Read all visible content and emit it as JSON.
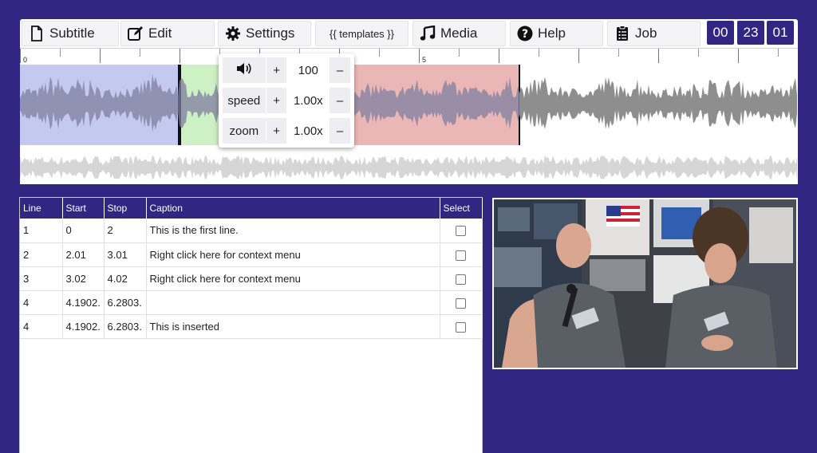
{
  "toolbar": {
    "subtitle": "Subtitle",
    "edit": "Edit",
    "settings": "Settings",
    "templates": "{{ templates }}",
    "media": "Media",
    "help": "Help",
    "job": "Job",
    "icons": [
      "file-icon",
      "edit-icon",
      "gear-icon",
      "music-icon",
      "help-icon",
      "clipboard-icon"
    ]
  },
  "timer": {
    "hours": "00",
    "minutes": "23",
    "seconds": "01"
  },
  "ruler": {
    "mark0": "0",
    "mark5": "5"
  },
  "audio": {
    "volume_value": "100",
    "speed_label": "speed",
    "speed_value": "1.00x",
    "zoom_label": "zoom",
    "zoom_value": "1.00x",
    "plus": "+",
    "minus": "–"
  },
  "table": {
    "headers": [
      "Line",
      "Start",
      "Stop",
      "Caption",
      "Select"
    ],
    "rows": [
      {
        "line": "1",
        "start": "0",
        "stop": "2",
        "caption": "This is the first line."
      },
      {
        "line": "2",
        "start": "2.01",
        "stop": "3.01",
        "caption": "Right click here for context menu"
      },
      {
        "line": "3",
        "start": "3.02",
        "stop": "4.02",
        "caption": "Right click here for context menu"
      },
      {
        "line": "4",
        "start": "4.1902.",
        "stop": "6.2803.",
        "caption": ""
      },
      {
        "line": "4",
        "start": "4.1902.",
        "stop": "6.2803.",
        "caption": "This is inserted"
      }
    ]
  },
  "colors": {
    "brand": "#312783",
    "region1": "#c3c9ef",
    "region2": "#cdf0c4",
    "region3": "#ebb6b6"
  }
}
